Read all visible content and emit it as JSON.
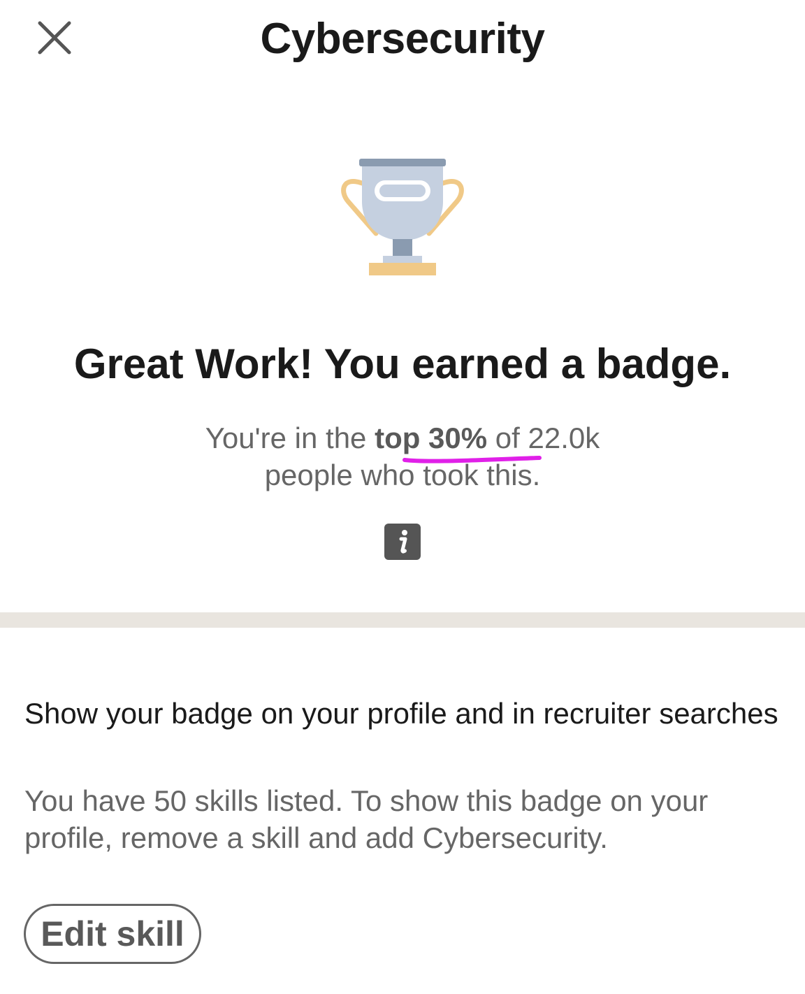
{
  "header": {
    "title": "Cybersecurity",
    "close_icon": "close-icon"
  },
  "result": {
    "icon": "trophy-icon",
    "headline": "Great Work! You earned a badge.",
    "stat_prefix": "You're in the ",
    "stat_highlight": "top 30%",
    "stat_middle": " of 22.0k",
    "stat_line2": "people who took this.",
    "info_icon": "info-icon",
    "annotation_color": "#e020e8"
  },
  "profile_section": {
    "title": "Show your badge on your profile and in recruiter searches",
    "body": "You have 50 skills listed. To show this badge on your profile, remove a skill and add Cybersecurity.",
    "button_label": "Edit skill"
  },
  "colors": {
    "divider": "#e9e5df",
    "trophy_cup": "#c5d0e0",
    "trophy_rim": "#8a9bb0",
    "trophy_gold": "#f0c987"
  }
}
